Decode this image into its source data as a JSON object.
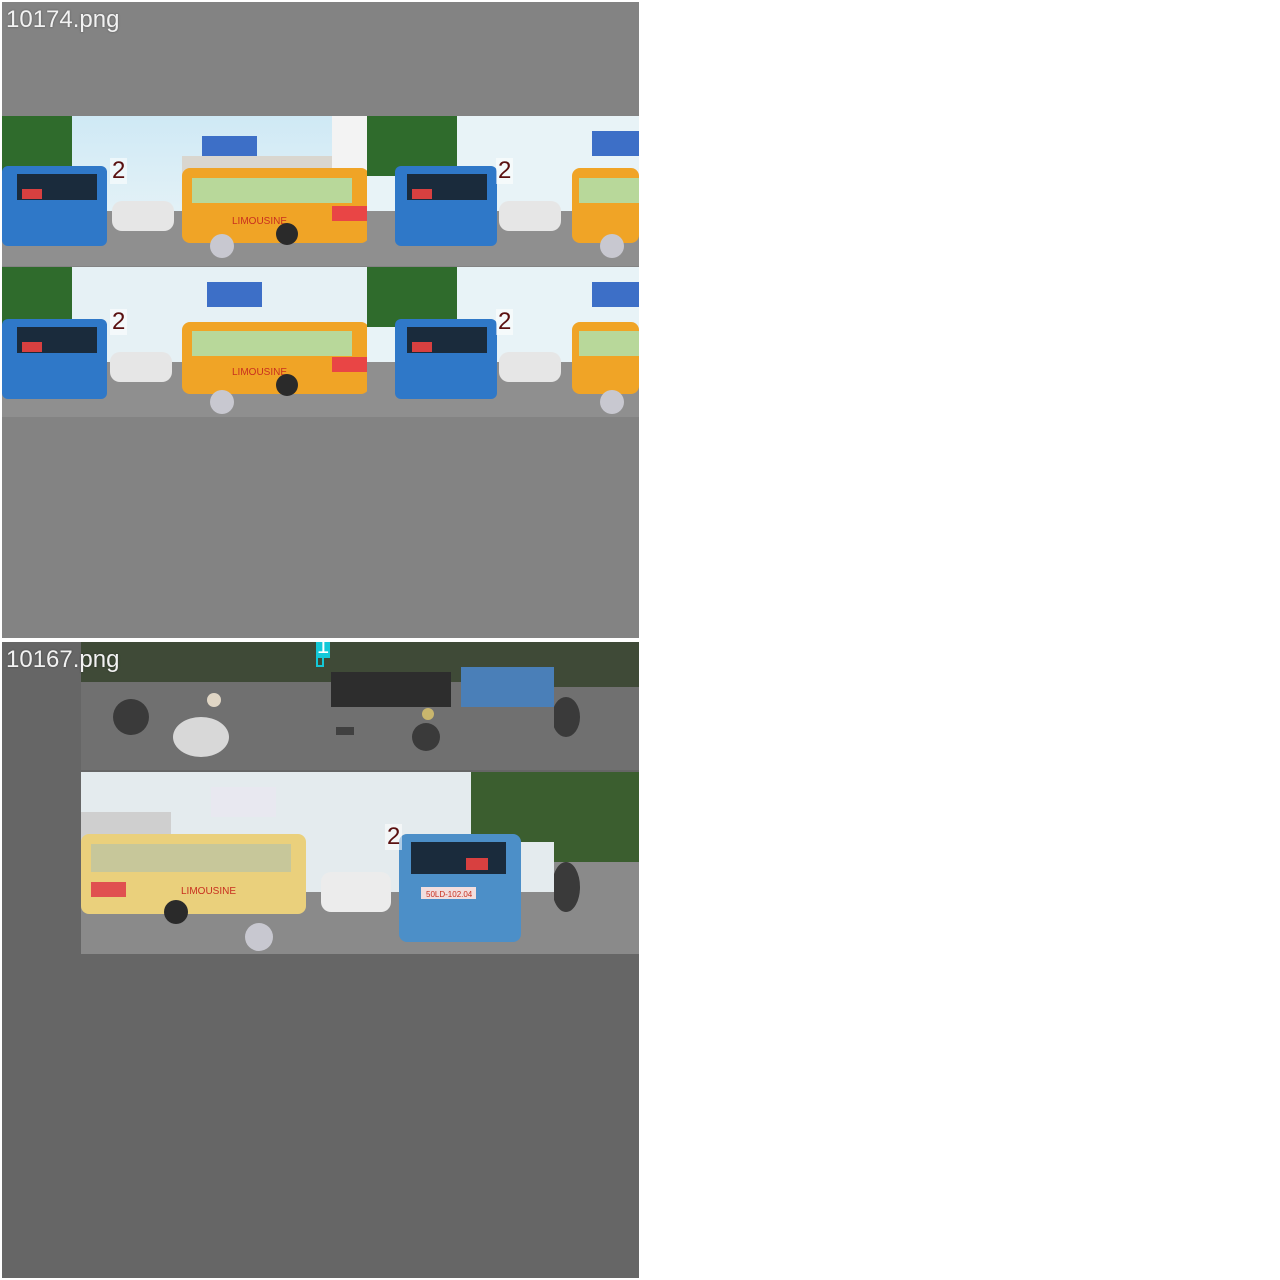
{
  "panels": [
    {
      "filename": "10174.png",
      "background": "#838383"
    },
    {
      "filename": "10167.png",
      "background": "#666666"
    }
  ],
  "labels": {
    "object_2": "2",
    "object_1": "1"
  },
  "bus_text": {
    "limousine": "LIMOUSINE",
    "plate": "50LD-102.04",
    "route": "04"
  },
  "colors": {
    "bus_blue": "#2f78c8",
    "bus_yellow": "#f0a426",
    "label_text": "#5a1010",
    "label_cyan": "#14c8d8"
  }
}
